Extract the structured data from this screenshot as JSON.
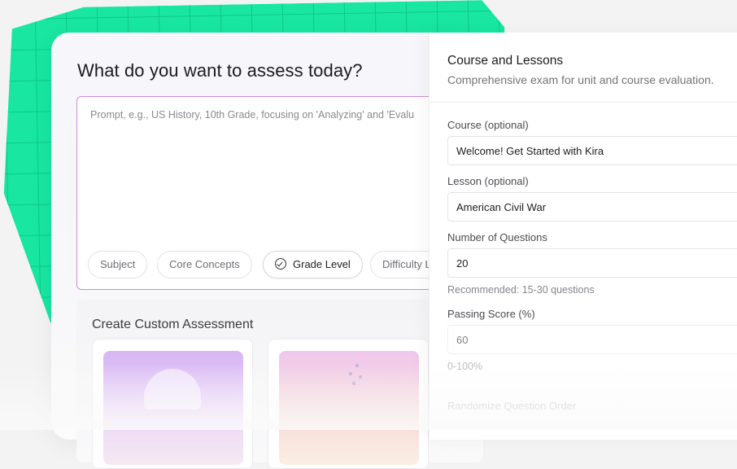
{
  "main": {
    "headline": "What do you want to assess today?",
    "prompt": {
      "placeholder": "Prompt, e.g., US History, 10th Grade, focusing on 'Analyzing' and 'Evalu",
      "value": ""
    },
    "chips": [
      {
        "label": "Subject",
        "active": false
      },
      {
        "label": "Core Concepts",
        "active": false
      },
      {
        "label": "Grade Level",
        "active": true,
        "icon": "check-circle-icon"
      },
      {
        "label": "Difficulty L",
        "active": false
      }
    ],
    "custom_assessment": {
      "title": "Create Custom Assessment"
    }
  },
  "panel": {
    "title": "Course and Lessons",
    "subtitle": "Comprehensive exam for unit and course evaluation.",
    "fields": {
      "course": {
        "label": "Course (optional)",
        "value": "Welcome! Get Started with Kira"
      },
      "lesson": {
        "label": "Lesson (optional)",
        "value": "American Civil War"
      },
      "num_questions": {
        "label": "Number of Questions",
        "value": "20",
        "help": "Recommended: 15-30 questions"
      },
      "passing_score": {
        "label": "Passing Score (%)",
        "value": "60",
        "help": "0-100%"
      },
      "randomize": {
        "label": "Randomize Question Order"
      }
    }
  },
  "colors": {
    "accent_green": "#18e6a1",
    "prompt_border": "#cf8cdc"
  }
}
